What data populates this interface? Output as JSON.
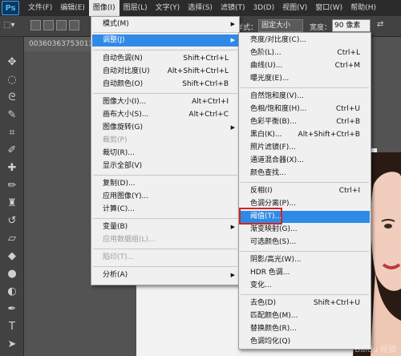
{
  "app_logo": "Ps",
  "menubar": [
    "文件(F)",
    "编辑(E)",
    "图像(I)",
    "图层(L)",
    "文字(Y)",
    "选择(S)",
    "滤镜(T)",
    "3D(D)",
    "视图(V)",
    "窗口(W)",
    "帮助(H)"
  ],
  "options": {
    "style_label": "样式：",
    "style_value": "固定大小",
    "width_label": "宽度：",
    "width_value": "90 像素"
  },
  "document_tab": "00360363753013",
  "image_menu": {
    "items": [
      {
        "label": "模式(M)",
        "shortcut": "",
        "submenu": true,
        "disabled": false
      },
      {
        "label": "调整(J)",
        "shortcut": "",
        "submenu": true,
        "disabled": false,
        "active": true
      },
      {
        "label": "自动色调(N)",
        "shortcut": "Shift+Ctrl+L"
      },
      {
        "label": "自动对比度(U)",
        "shortcut": "Alt+Shift+Ctrl+L"
      },
      {
        "label": "自动颜色(O)",
        "shortcut": "Shift+Ctrl+B"
      },
      {
        "label": "图像大小(I)...",
        "shortcut": "Alt+Ctrl+I"
      },
      {
        "label": "画布大小(S)...",
        "shortcut": "Alt+Ctrl+C"
      },
      {
        "label": "图像旋转(G)",
        "shortcut": "",
        "submenu": true
      },
      {
        "label": "裁剪(P)",
        "shortcut": "",
        "disabled": true
      },
      {
        "label": "裁切(R)...",
        "shortcut": ""
      },
      {
        "label": "显示全部(V)",
        "shortcut": ""
      },
      {
        "label": "复制(D)...",
        "shortcut": ""
      },
      {
        "label": "应用图像(Y)...",
        "shortcut": ""
      },
      {
        "label": "计算(C)...",
        "shortcut": ""
      },
      {
        "label": "变量(B)",
        "shortcut": "",
        "submenu": true
      },
      {
        "label": "应用数据组(L)...",
        "shortcut": "",
        "disabled": true
      },
      {
        "label": "陷印(T)...",
        "shortcut": "",
        "disabled": true
      },
      {
        "label": "分析(A)",
        "shortcut": "",
        "submenu": true
      }
    ]
  },
  "adjust_menu": {
    "items": [
      {
        "label": "亮度/对比度(C)...",
        "shortcut": ""
      },
      {
        "label": "色阶(L)...",
        "shortcut": "Ctrl+L"
      },
      {
        "label": "曲线(U)...",
        "shortcut": "Ctrl+M"
      },
      {
        "label": "曝光度(E)...",
        "shortcut": ""
      },
      {
        "label": "自然饱和度(V)...",
        "shortcut": ""
      },
      {
        "label": "色相/饱和度(H)...",
        "shortcut": "Ctrl+U"
      },
      {
        "label": "色彩平衡(B)...",
        "shortcut": "Ctrl+B"
      },
      {
        "label": "黑白(K)...",
        "shortcut": "Alt+Shift+Ctrl+B"
      },
      {
        "label": "照片滤镜(F)...",
        "shortcut": ""
      },
      {
        "label": "通道混合器(X)...",
        "shortcut": ""
      },
      {
        "label": "颜色查找...",
        "shortcut": ""
      },
      {
        "label": "反相(I)",
        "shortcut": "Ctrl+I"
      },
      {
        "label": "色调分离(P)...",
        "shortcut": ""
      },
      {
        "label": "阈值(T)...",
        "shortcut": "",
        "highlight": true
      },
      {
        "label": "渐变映射(G)...",
        "shortcut": ""
      },
      {
        "label": "可选颜色(S)...",
        "shortcut": ""
      },
      {
        "label": "阴影/高光(W)...",
        "shortcut": ""
      },
      {
        "label": "HDR 色调...",
        "shortcut": ""
      },
      {
        "label": "变化...",
        "shortcut": ""
      },
      {
        "label": "去色(D)",
        "shortcut": "Shift+Ctrl+U"
      },
      {
        "label": "匹配颜色(M)...",
        "shortcut": ""
      },
      {
        "label": "替换颜色(R)...",
        "shortcut": ""
      },
      {
        "label": "色调均化(Q)",
        "shortcut": ""
      }
    ]
  },
  "watermark": "Baidu 经验",
  "colors": {
    "highlight": "#2f8ae6",
    "callout": "#d32424"
  }
}
